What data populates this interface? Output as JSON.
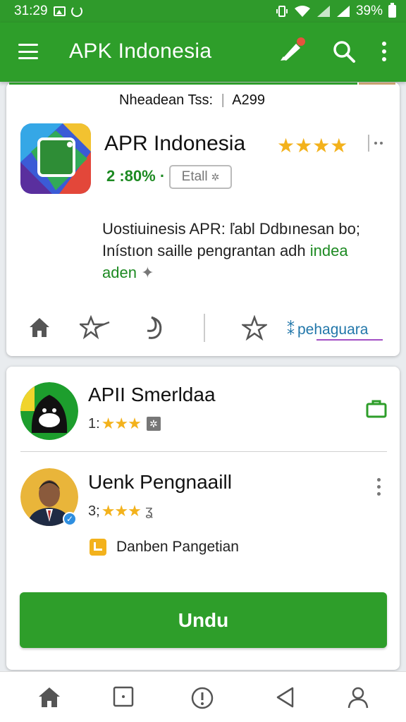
{
  "status_bar": {
    "time": "31:29",
    "battery": "39%"
  },
  "app_bar": {
    "title": "APK Indonesia"
  },
  "app_card": {
    "header": "Nheadean Tss:",
    "header_code": "A299",
    "name": "APR Indonesia",
    "stars": "★★★★",
    "rating_pct": "2 :80% ·",
    "install_label": "Etall",
    "description_l1": "Uostiuinesis APR: ľabl Ddbınesan bo;",
    "description_l2": "Inístıon saille pengrantan adh",
    "description_green": "indea",
    "description_l3_green": "aden",
    "brand": "pehaguara",
    "colors": {
      "accent": "#2e9e2a",
      "star": "#f3b21c",
      "brand": "#2277aa"
    }
  },
  "list_card": {
    "item1": {
      "name": "APII Smerldaa",
      "rating_num": "1:",
      "stars": "★★★"
    },
    "item2": {
      "name": "Uenk Pengnaaill",
      "rating_num": "3;",
      "stars": "★★★"
    },
    "feature": "Danben Pangetian",
    "download_label": "Undu"
  }
}
